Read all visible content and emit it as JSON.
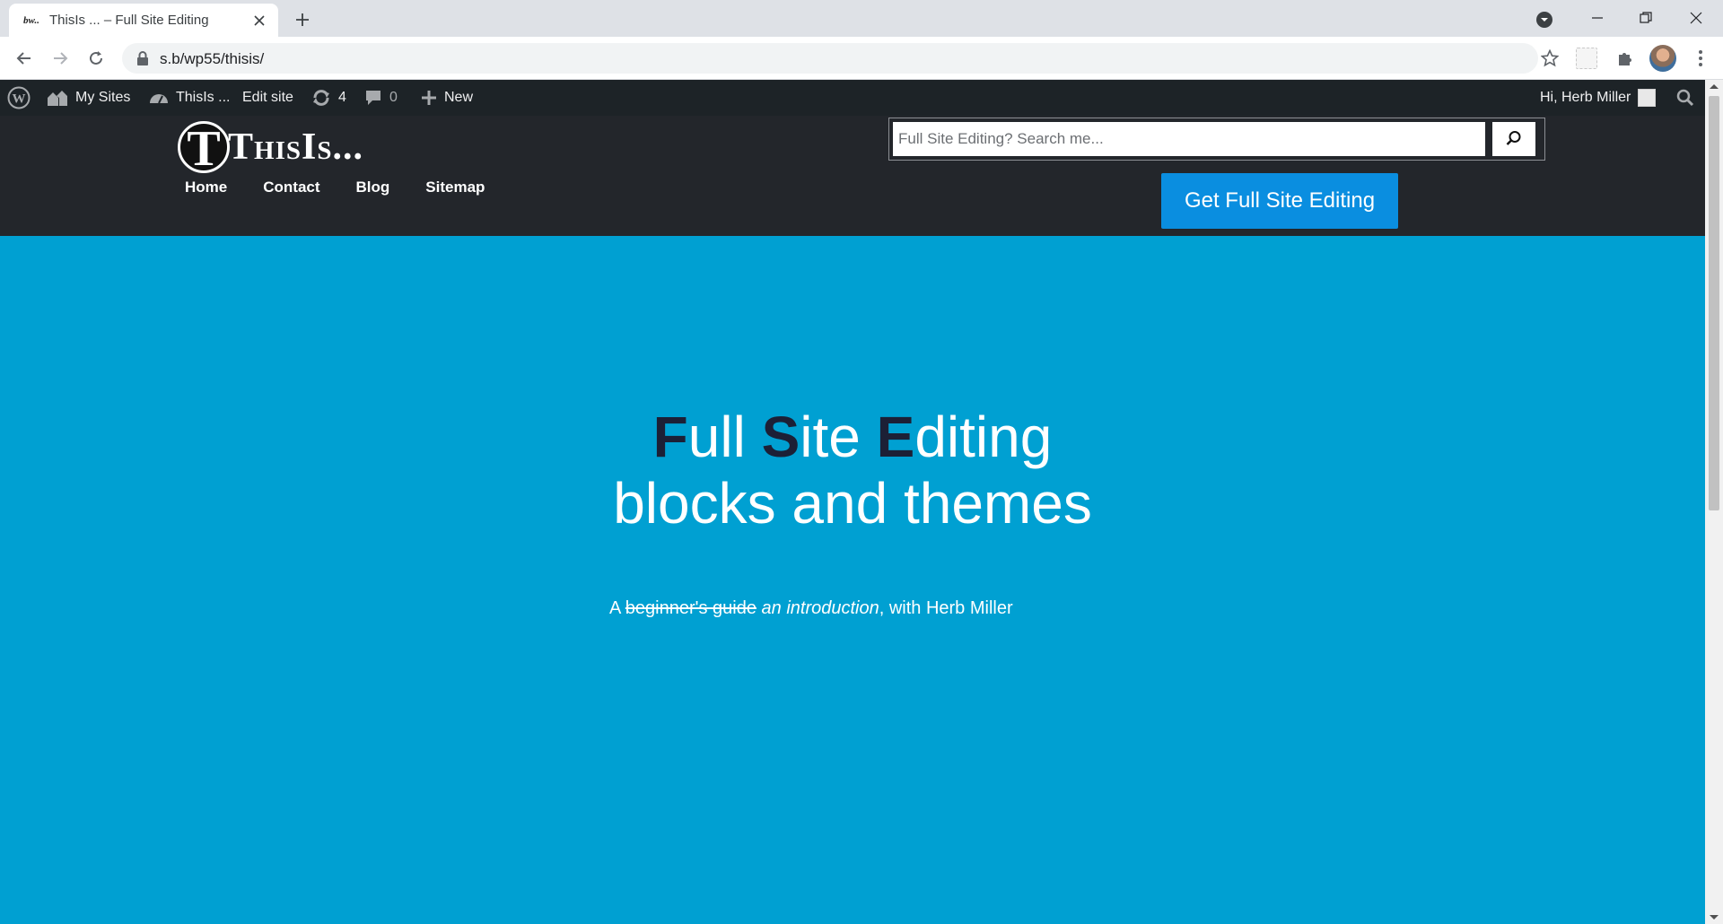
{
  "browser": {
    "tab": {
      "favicon_text": "bw..",
      "title": "ThisIs ... – Full Site Editing"
    },
    "url": "s.b/wp55/thisis/",
    "icons": [
      "close-icon",
      "plus-icon",
      "tab-search-icon",
      "minimize-icon",
      "restore-icon",
      "window-close-icon",
      "back-icon",
      "forward-icon",
      "reload-icon",
      "lock-icon",
      "star-icon",
      "puzzle-icon",
      "kebab-menu-icon"
    ]
  },
  "adminbar": {
    "my_sites": "My Sites",
    "site_name": "ThisIs ...",
    "edit_site": "Edit site",
    "updates_count": "4",
    "comments_count": "0",
    "new_label": "New",
    "greeting": "Hi, Herb Miller"
  },
  "site": {
    "logo_letter": "T",
    "logo_text": "ThisIs...",
    "nav": [
      "Home",
      "Contact",
      "Blog",
      "Sitemap"
    ],
    "search_placeholder": "Full Site Editing? Search me...",
    "cta_label": "Get Full Site Editing"
  },
  "hero": {
    "title_line1_parts": [
      "F",
      "ull ",
      "S",
      "ite ",
      "E",
      "diting"
    ],
    "title_line2": "blocks and themes",
    "sub_prefix": "A ",
    "sub_struck": "beginner's guide",
    "sub_italic": "an introduction",
    "sub_suffix": ", with Herb Miller"
  },
  "colors": {
    "hero_bg": "#00a0d2",
    "header_bg": "#23262b",
    "adminbar_bg": "#1d2327",
    "cta_bg": "#0a8ee0",
    "title_accent": "#1c2036"
  }
}
